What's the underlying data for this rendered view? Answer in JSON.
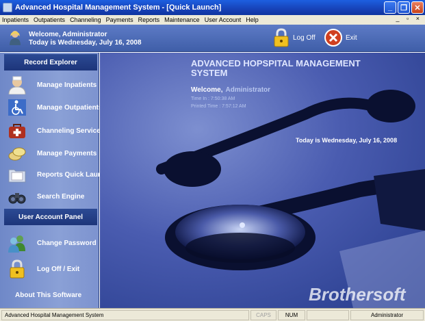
{
  "window": {
    "title": "Advanced Hospital Management System - [Quick Launch]",
    "minimize_glyph": "_",
    "restore_glyph": "❐",
    "close_glyph": "✕"
  },
  "menu": {
    "items": [
      "Inpatients",
      "Outpatients",
      "Channeling",
      "Payments",
      "Reports",
      "Maintenance",
      "User Account",
      "Help"
    ],
    "mdi_controls": "_ ▫ ×"
  },
  "header": {
    "welcome": "Welcome, Administrator",
    "date": "Today is Wednesday, July 16, 2008",
    "logoff_label": "Log Off",
    "exit_label": "Exit"
  },
  "sidebar": {
    "record_explorer": "Record Explorer",
    "items": [
      {
        "label": "Manage Inpatients",
        "icon": "nurse-icon"
      },
      {
        "label": "Manage Outpatients",
        "icon": "wheelchair-icon"
      },
      {
        "label": "Channeling Services",
        "icon": "doctor-bag-icon"
      },
      {
        "label": "Manage Payments",
        "icon": "coins-icon"
      },
      {
        "label": "Reports Quick Launch",
        "icon": "folder-icon"
      },
      {
        "label": "Search Engine",
        "icon": "binoculars-icon"
      }
    ],
    "user_account_panel": "User Account Panel",
    "account_items": [
      {
        "label": "Change Password",
        "icon": "users-icon"
      },
      {
        "label": "Log Off / Exit",
        "icon": "padlock-icon"
      }
    ],
    "about": "About This Software"
  },
  "main": {
    "title": "ADVANCED HOPSPITAL MANAGEMENT SYSTEM",
    "welcome_label": "Welcome,",
    "welcome_name": "Administrator",
    "time_in": "Time In : 7:50:38 AM",
    "printed_time": "Printed Time : 7:57:12 AM",
    "today": "Today is Wednesday, July 16, 2008",
    "watermark": "Brothersoft"
  },
  "statusbar": {
    "app": "Advanced Hospital Management System",
    "caps": "CAPS",
    "num": "NUM",
    "blank": "",
    "user": "Administrator"
  },
  "colors": {
    "titlebar": "#1742b8",
    "header": "#4f6db8",
    "sidebar": "#8aa0d6",
    "section_head": "#24418a",
    "main_bg": "#4a5cb0"
  }
}
